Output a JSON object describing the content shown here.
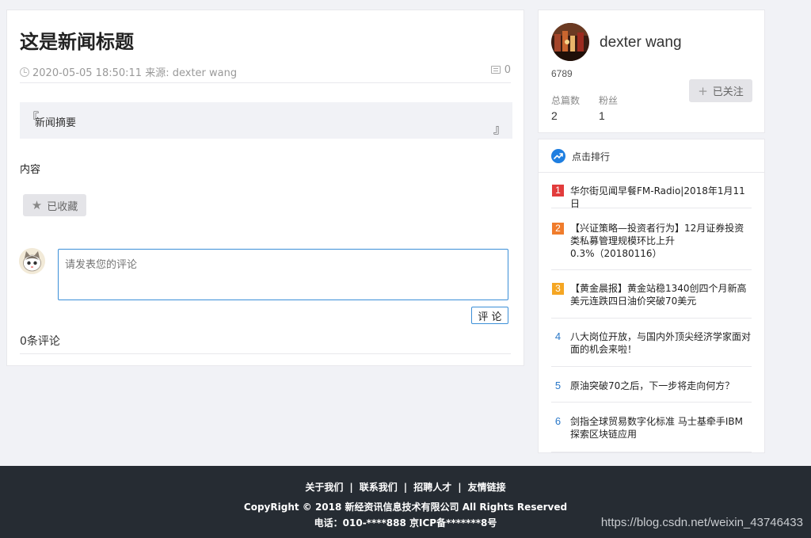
{
  "article": {
    "title": "这是新闻标题",
    "datetime": "2020-05-05 18:50:11",
    "source": "来源: dexter wang",
    "comment_count": "0",
    "summary": "新闻摘要",
    "quote_open": "『",
    "quote_close": "』",
    "content": "内容",
    "collect_label": "已收藏",
    "comment_placeholder": "请发表您的评论",
    "comment_button": "评 论",
    "comment_total": "0条评论"
  },
  "profile": {
    "name": "dexter wang",
    "user_id": "6789",
    "posts_label": "总篇数",
    "posts_value": "2",
    "fans_label": "粉丝",
    "fans_value": "1",
    "follow_label": "已关注"
  },
  "ranking": {
    "title": "点击排行",
    "items": [
      {
        "rank": "1",
        "text": "华尔街见闻早餐FM-Radio|2018年1月11日",
        "color": "#e23c3c"
      },
      {
        "rank": "2",
        "text": "【兴证策略—投资者行为】12月证券投资类私募管理规模环比上升0.3%（20180116）",
        "color": "#f07c2c"
      },
      {
        "rank": "3",
        "text": "【黄金晨报】黄金站稳1340创四个月新高 美元连跌四日油价突破70美元",
        "color": "#f5a623"
      },
      {
        "rank": "4",
        "text": "八大岗位开放，与国内外顶尖经济学家面对面的机会来啦！",
        "color": ""
      },
      {
        "rank": "5",
        "text": "原油突破70之后，下一步将走向何方？",
        "color": ""
      },
      {
        "rank": "6",
        "text": "剑指全球贸易数字化标准 马士基牵手IBM探索区块链应用",
        "color": ""
      }
    ]
  },
  "footer": {
    "links": [
      "关于我们",
      "联系我们",
      "招聘人才",
      "友情链接"
    ],
    "separator": "|",
    "copyright": "CopyRight © 2018 新经资讯信息技术有限公司 All Rights Reserved",
    "phone": "电话：010-****888 京ICP备*******8号",
    "watermark": "https://blog.csdn.net/weixin_43746433"
  },
  "colors": {
    "accent": "#3b8fd8",
    "footer_bg": "#262c33",
    "rank_blue": "#2a78c8"
  }
}
